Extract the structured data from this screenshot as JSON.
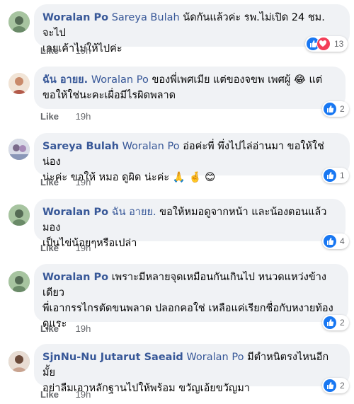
{
  "comments": [
    {
      "author": "Woralan Po",
      "mention": "Sareya Bulah",
      "line1": "นัดกันแล้วค่ะ รพ.ไม่เปิด 24 ชม. จะไป",
      "line2": "เลยเค้าไม่ให้ไปค่ะ",
      "like": "Like",
      "time": "19h",
      "reactions": [
        "like",
        "love"
      ],
      "count": "13"
    },
    {
      "author": "ฉัน อายย.",
      "mention": "Woralan Po",
      "line1": "ของพี่เพศเมีย แต่ของจขพ เพศผู้ 😂 แต่",
      "line2": "ขอให้ใช่นะคะเผื่อมีไรผิดพลาด",
      "like": "Like",
      "time": "19h",
      "reactions": [
        "like"
      ],
      "count": "2"
    },
    {
      "author": "Sareya Bulah",
      "mention": "Woralan Po",
      "line1": "อ่อค่ะพี่ พึ่งไปไล่อ่านมา ขอให้ใช่ น่อง",
      "line2": "น่ะค่ะ ขอให้ หมอ ดูผิด น่ะค่ะ 🙏 🤞 😊",
      "like": "Like",
      "time": "19h",
      "reactions": [
        "like"
      ],
      "count": "1"
    },
    {
      "author": "Woralan Po",
      "mention": "ฉัน อายย.",
      "line1": "ขอให้หมอดูจากหน้า และน้องตอนแล้วมอง",
      "line2": "เป็นไข่น้อยๆหรือเปล่า",
      "like": "Like",
      "time": "19h",
      "reactions": [
        "like"
      ],
      "count": "4"
    },
    {
      "author": "Woralan Po",
      "mention": "",
      "line1": "เพราะมีหลายจุดเหมือนกันเกินไป หนวดแหว่งข้างเดียว",
      "line2": "พี่เอากรรไกรตัดขนพลาด ปลอกคอใช่ เหลือแค่เรียกชื่อกับหงายท้อง",
      "line3": "ดูแระ",
      "like": "Like",
      "time": "19h",
      "reactions": [
        "like"
      ],
      "count": "2"
    },
    {
      "author": "SjnNu-Nu Jutarut Saeaid",
      "mention": "Woralan Po",
      "line1": "มีตำหนิตรงไหนอีกมั้ย",
      "line2": "อย่าลืมเอาหลักฐานไปให้พร้อม ขวัญเอ้ยขวัญมา",
      "like": "Like",
      "time": "19h",
      "reactions": [
        "like"
      ],
      "count": "2"
    }
  ],
  "colors": {
    "name": "#385898",
    "bubble": "#f0f2f5",
    "like": "#1877f2",
    "love": "#f33e58"
  }
}
